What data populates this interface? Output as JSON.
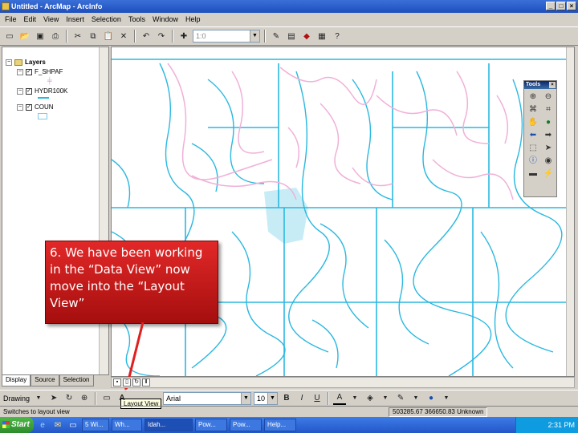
{
  "window": {
    "title": "Untitled - ArcMap - ArcInfo"
  },
  "menu": [
    "File",
    "Edit",
    "View",
    "Insert",
    "Selection",
    "Tools",
    "Window",
    "Help"
  ],
  "toolbar": {
    "scale_value": "1:0"
  },
  "toc": {
    "root": "Layers",
    "layers": [
      {
        "name": "F_SHPAF",
        "checked": true
      },
      {
        "name": "HYDR100K",
        "checked": true
      },
      {
        "name": "COUN",
        "checked": true
      }
    ],
    "tabs": [
      "Display",
      "Source",
      "Selection"
    ]
  },
  "tools_palette": {
    "title": "Tools"
  },
  "callout": {
    "text": "6. We have been working in the “Data View” now move into the “Layout View”"
  },
  "tooltip": {
    "text": "Layout View"
  },
  "drawing_toolbar": {
    "label": "Drawing",
    "font": "Arial",
    "font_size": "10"
  },
  "status": {
    "message": "Switches to layout view",
    "coordinates": "503285.67 366650.83 Unknown"
  },
  "taskbar": {
    "start_label": "Start",
    "tasks": [
      "5 Wi...",
      "Wh...",
      "Idah...",
      "Pow...",
      "Pow...",
      "Help..."
    ],
    "clock": "2:31 PM"
  },
  "colors": {
    "rivers": "#2ab8e0",
    "roads": "#f0b0d8",
    "callout": "#d01a1a"
  }
}
